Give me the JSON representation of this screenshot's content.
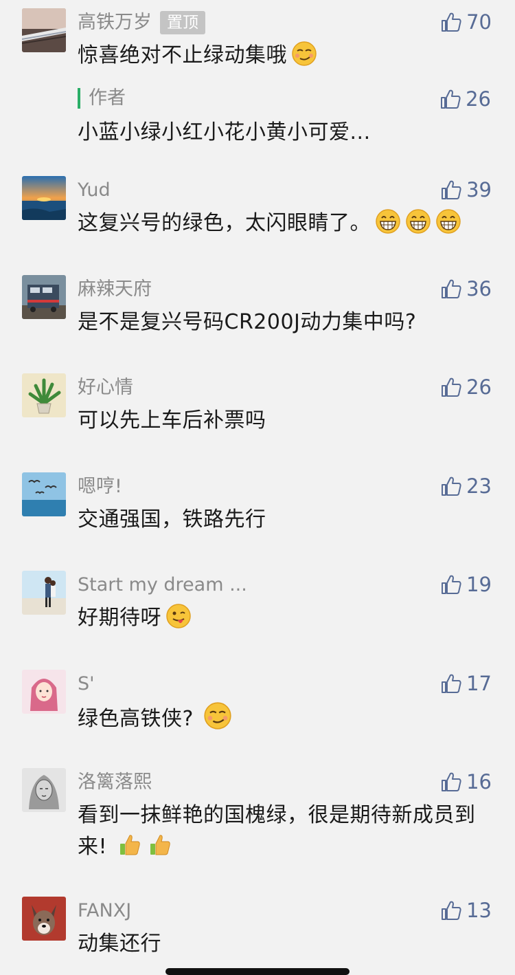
{
  "comments": [
    {
      "name": "高铁万岁",
      "badge": "置顶",
      "text": "惊喜绝对不止绿动集哦",
      "likes": "70",
      "avatar_icon": "train-photo",
      "emoji": [
        "smirk-emoji"
      ],
      "author_reply": {
        "tag": "作者",
        "text": "小蓝小绿小红小花小黄小可爱...",
        "likes": "26"
      }
    },
    {
      "name": "Yud",
      "text": "这复兴号的绿色，太闪眼睛了。",
      "likes": "39",
      "avatar_icon": "sunset-sea-photo",
      "emoji": [
        "grin-emoji",
        "grin-emoji",
        "grin-emoji"
      ]
    },
    {
      "name": "麻辣天府",
      "text": "是不是复兴号码CR200J动力集中吗?",
      "likes": "36",
      "avatar_icon": "locomotive-photo"
    },
    {
      "name": "好心情",
      "text": "可以先上车后补票吗",
      "likes": "26",
      "avatar_icon": "potted-plant-photo"
    },
    {
      "name": "嗯哼!",
      "text": "交通强国，铁路先行",
      "likes": "23",
      "avatar_icon": "seagulls-sea-photo"
    },
    {
      "name": "Start my dream ...",
      "text": "好期待呀",
      "likes": "19",
      "avatar_icon": "couple-beach-photo",
      "emoji": [
        "wink-tongue-emoji"
      ]
    },
    {
      "name": "S'",
      "text": "绿色高铁侠?",
      "likes": "17",
      "avatar_icon": "anime-girl-photo",
      "emoji": [
        "smirk-emoji"
      ]
    },
    {
      "name": "洛篱落熙",
      "text": "看到一抹鲜艳的国槐绿，很是期待新成员到来!",
      "likes": "16",
      "avatar_icon": "sketch-portrait-photo",
      "emoji": [
        "thumbs-up-emoji",
        "thumbs-up-emoji"
      ]
    },
    {
      "name": "FANXJ",
      "text": "动集还行",
      "likes": "13",
      "avatar_icon": "dog-photo"
    }
  ],
  "colors": {
    "background": "#f2f2f2",
    "like_accent": "#576b95",
    "author_bar": "#2aae67",
    "name_gray": "#8a8a8a"
  }
}
